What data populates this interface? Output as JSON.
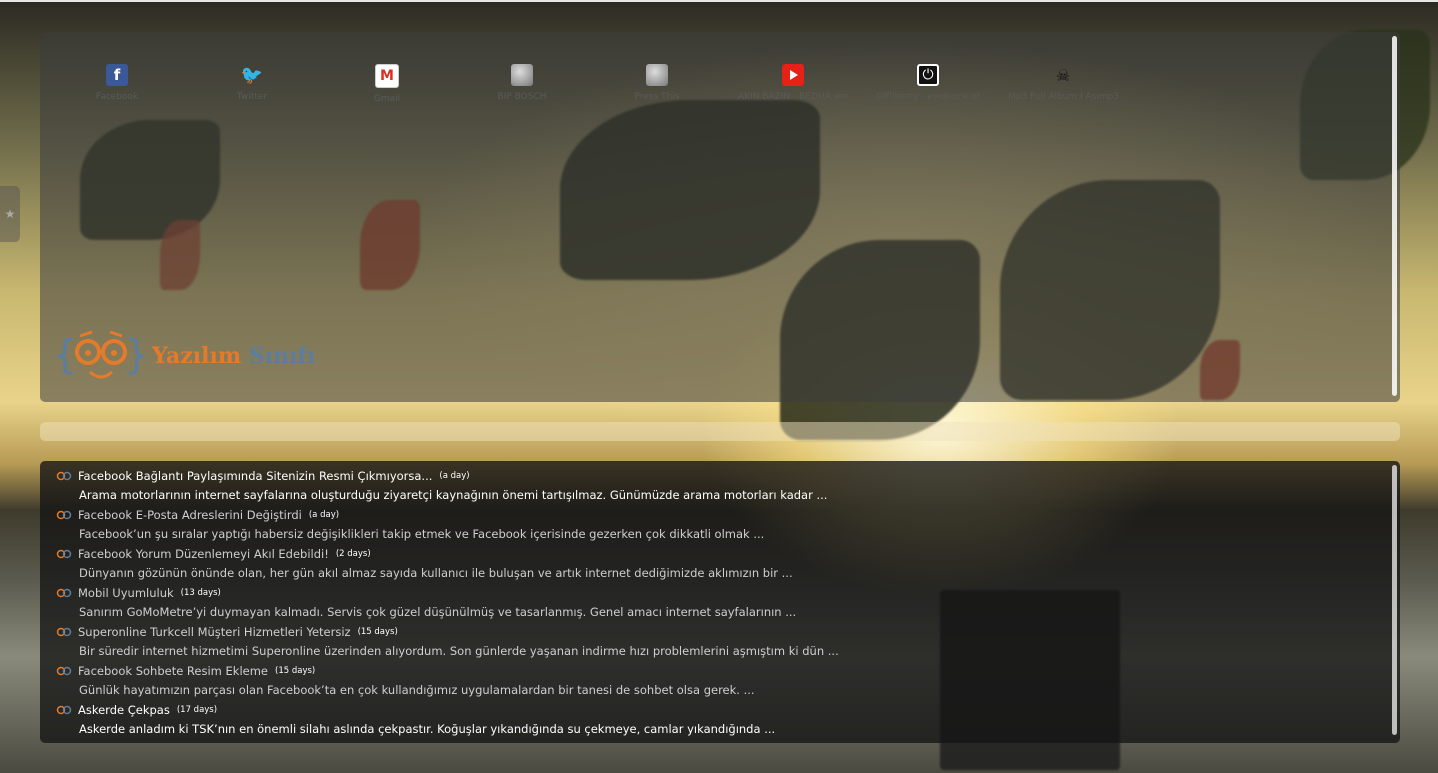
{
  "quick_links": [
    {
      "label": "Facebook",
      "icon": "facebook-icon"
    },
    {
      "label": "Twitter",
      "icon": "twitter-icon"
    },
    {
      "label": "Gmail",
      "icon": "gmail-icon"
    },
    {
      "label": "BIP BOSCH",
      "icon": "globe-icon"
    },
    {
      "label": "Press This",
      "icon": "globe-icon"
    },
    {
      "label": "AKIN BAZIN - BEDUA.wmv",
      "icon": "youtube-icon"
    },
    {
      "label": "Offliberty - evidence of",
      "icon": "power-icon"
    },
    {
      "label": "Mp3 Full Album I Asimp3 -",
      "icon": "mp3-icon"
    }
  ],
  "logo": {
    "part1": "Yazılım",
    "part2": "Sınıfı"
  },
  "feed": {
    "items": [
      {
        "title": "Facebook Bağlantı Paylaşımında Sitenizin Resmi Çıkmıyorsa...",
        "age": "(a day)",
        "excerpt": "Arama motorlarının internet sayfalarına oluşturduğu ziyaretçi kaynağının önemi tartışılmaz. Günümüzde arama motorları kadar ..."
      },
      {
        "title": "Facebook E-Posta Adreslerini Değiştirdi",
        "age": "(a day)",
        "excerpt": "Facebook’un  şu sıralar yaptığı habersiz değişiklikleri takip etmek ve Facebook içerisinde gezerken çok dikkatli olmak ..."
      },
      {
        "title": "Facebook Yorum Düzenlemeyi Akıl Edebildi!",
        "age": "(2 days)",
        "excerpt": "Dünyanın gözünün önünde olan, her gün akıl almaz sayıda kullanıcı ile buluşan ve artık internet dediğimizde aklımızın bir ..."
      },
      {
        "title": "Mobil Uyumluluk",
        "age": "(13 days)",
        "excerpt": "Sanırım GoMoMetre’yi duymayan kalmadı. Servis çok güzel düşünülmüş ve tasarlanmış. Genel amacı internet sayfalarının ..."
      },
      {
        "title": "Superonline Turkcell Müşteri Hizmetleri Yetersiz",
        "age": "(15 days)",
        "excerpt": "Bir süredir internet hizmetimi Superonline üzerinden alıyordum. Son günlerde yaşanan indirme hızı problemlerini aşmıştım ki dün ..."
      },
      {
        "title": "Facebook Sohbete Resim Ekleme",
        "age": "(15 days)",
        "excerpt": "Günlük hayatımızın parçası olan Facebook’ta en çok kullandığımız uygulamalardan bir tanesi de sohbet olsa gerek. ..."
      },
      {
        "title": "Askerde Çekpas",
        "age": "(17 days)",
        "excerpt": "Askerde anladım ki TSK’nın en önemli silahı aslında çekpastır. Koğuşlar yıkandığında su çekmeye, camlar yıkandığında ..."
      }
    ]
  }
}
